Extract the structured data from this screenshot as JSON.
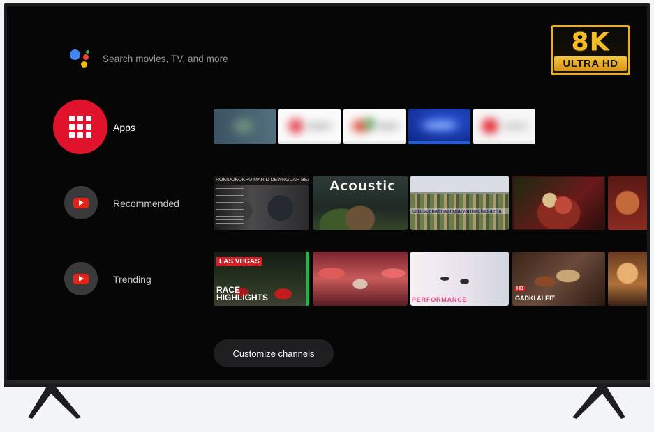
{
  "search": {
    "placeholder": "Search movies, TV, and more"
  },
  "badge": {
    "resolution": "8K",
    "label": "ULTRA HD"
  },
  "rail": [
    {
      "label": "Apps",
      "icon": "apps-grid-icon"
    },
    {
      "label": "Recommended",
      "icon": "youtube-icon"
    },
    {
      "label": "Trending",
      "icon": "youtube-icon"
    }
  ],
  "recommended": {
    "thumbnails": [
      {
        "overlay_text": "ROKIDOKOKPU MARID DEWNGDAH BEAN"
      },
      {
        "overlay_text": "Acoustic"
      },
      {
        "overlay_text": "cardscenaenaangsuvarmachasaena"
      },
      {
        "overlay_text": ""
      },
      {
        "overlay_text": ""
      }
    ]
  },
  "trending": {
    "thumbnails": [
      {
        "tag": "LAS VEGAS",
        "title_line1": "RACE",
        "title_line2": "HIGHLIGHTS"
      },
      {
        "overlay_text": ""
      },
      {
        "overlay_text": "PERFORMANCE"
      },
      {
        "tag": "HD",
        "overlay_text": "GADKI ALEIT"
      },
      {
        "overlay_text": ""
      }
    ]
  },
  "customize_button": {
    "label": "Customize channels"
  },
  "colors": {
    "apps_red": "#e1132c",
    "youtube_red": "#e62117",
    "badge_gold": "#f3bd28"
  }
}
